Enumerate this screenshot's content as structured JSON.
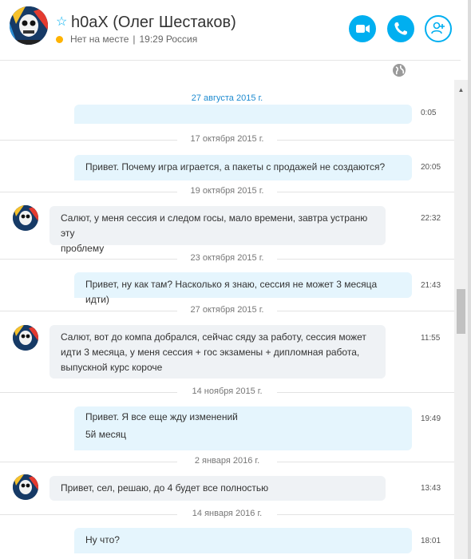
{
  "header": {
    "contact_name": "h0aX (Олег Шестаков)",
    "status_text": "Нет на месте",
    "separator": "|",
    "local_time": "19:29 Россия",
    "icons": {
      "favorite": "star-icon",
      "status": "clock-icon",
      "video": "video-call-icon",
      "call": "phone-icon",
      "add": "add-people-icon",
      "globe": "globe-icon"
    }
  },
  "colors": {
    "accent": "#00aff0",
    "away": "#ffb300",
    "outgoing_bubble": "#e5f5fd",
    "incoming_bubble": "#eff2f5"
  },
  "chat": {
    "date_1": "27 августа 2015 г.",
    "partial_time": "0:05",
    "date_2": "17 октября 2015 г.",
    "msg_1": "Привет. Почему игра играется, а пакеты с продажей не создаются?",
    "time_1": "20:05",
    "date_3": "19 октября 2015 г.",
    "msg_2_line_1": "Салют, у меня сессия и следом госы, мало времени, завтра устраню эту",
    "msg_2_line_2": "проблему",
    "time_2": "22:32",
    "date_4": "23 октября 2015 г.",
    "msg_3": "Привет, ну как там? Насколько я знаю, сессия не может 3 месяца идти)",
    "time_3": "21:43",
    "date_5": "27 октября 2015 г.",
    "msg_4_line_1": "Салют, вот до компа добрался, сейчас сяду за работу, сессия может",
    "msg_4_line_2": "идти 3 месяца, у меня сессия + гос экзамены + дипломная работа,",
    "msg_4_line_3": "выпускной курс короче",
    "time_4": "11:55",
    "date_6": "14 ноября 2015 г.",
    "msg_5_line_1": "Привет. Я все еще жду изменений",
    "msg_5_line_2": "5й месяц",
    "time_5": "19:49",
    "date_7": "2 января 2016 г.",
    "msg_6": "Привет, сел, решаю, до 4 будет все полностью",
    "time_6": "13:43",
    "date_8": "14 января 2016 г.",
    "msg_7": "Ну что?",
    "time_7": "18:01"
  }
}
